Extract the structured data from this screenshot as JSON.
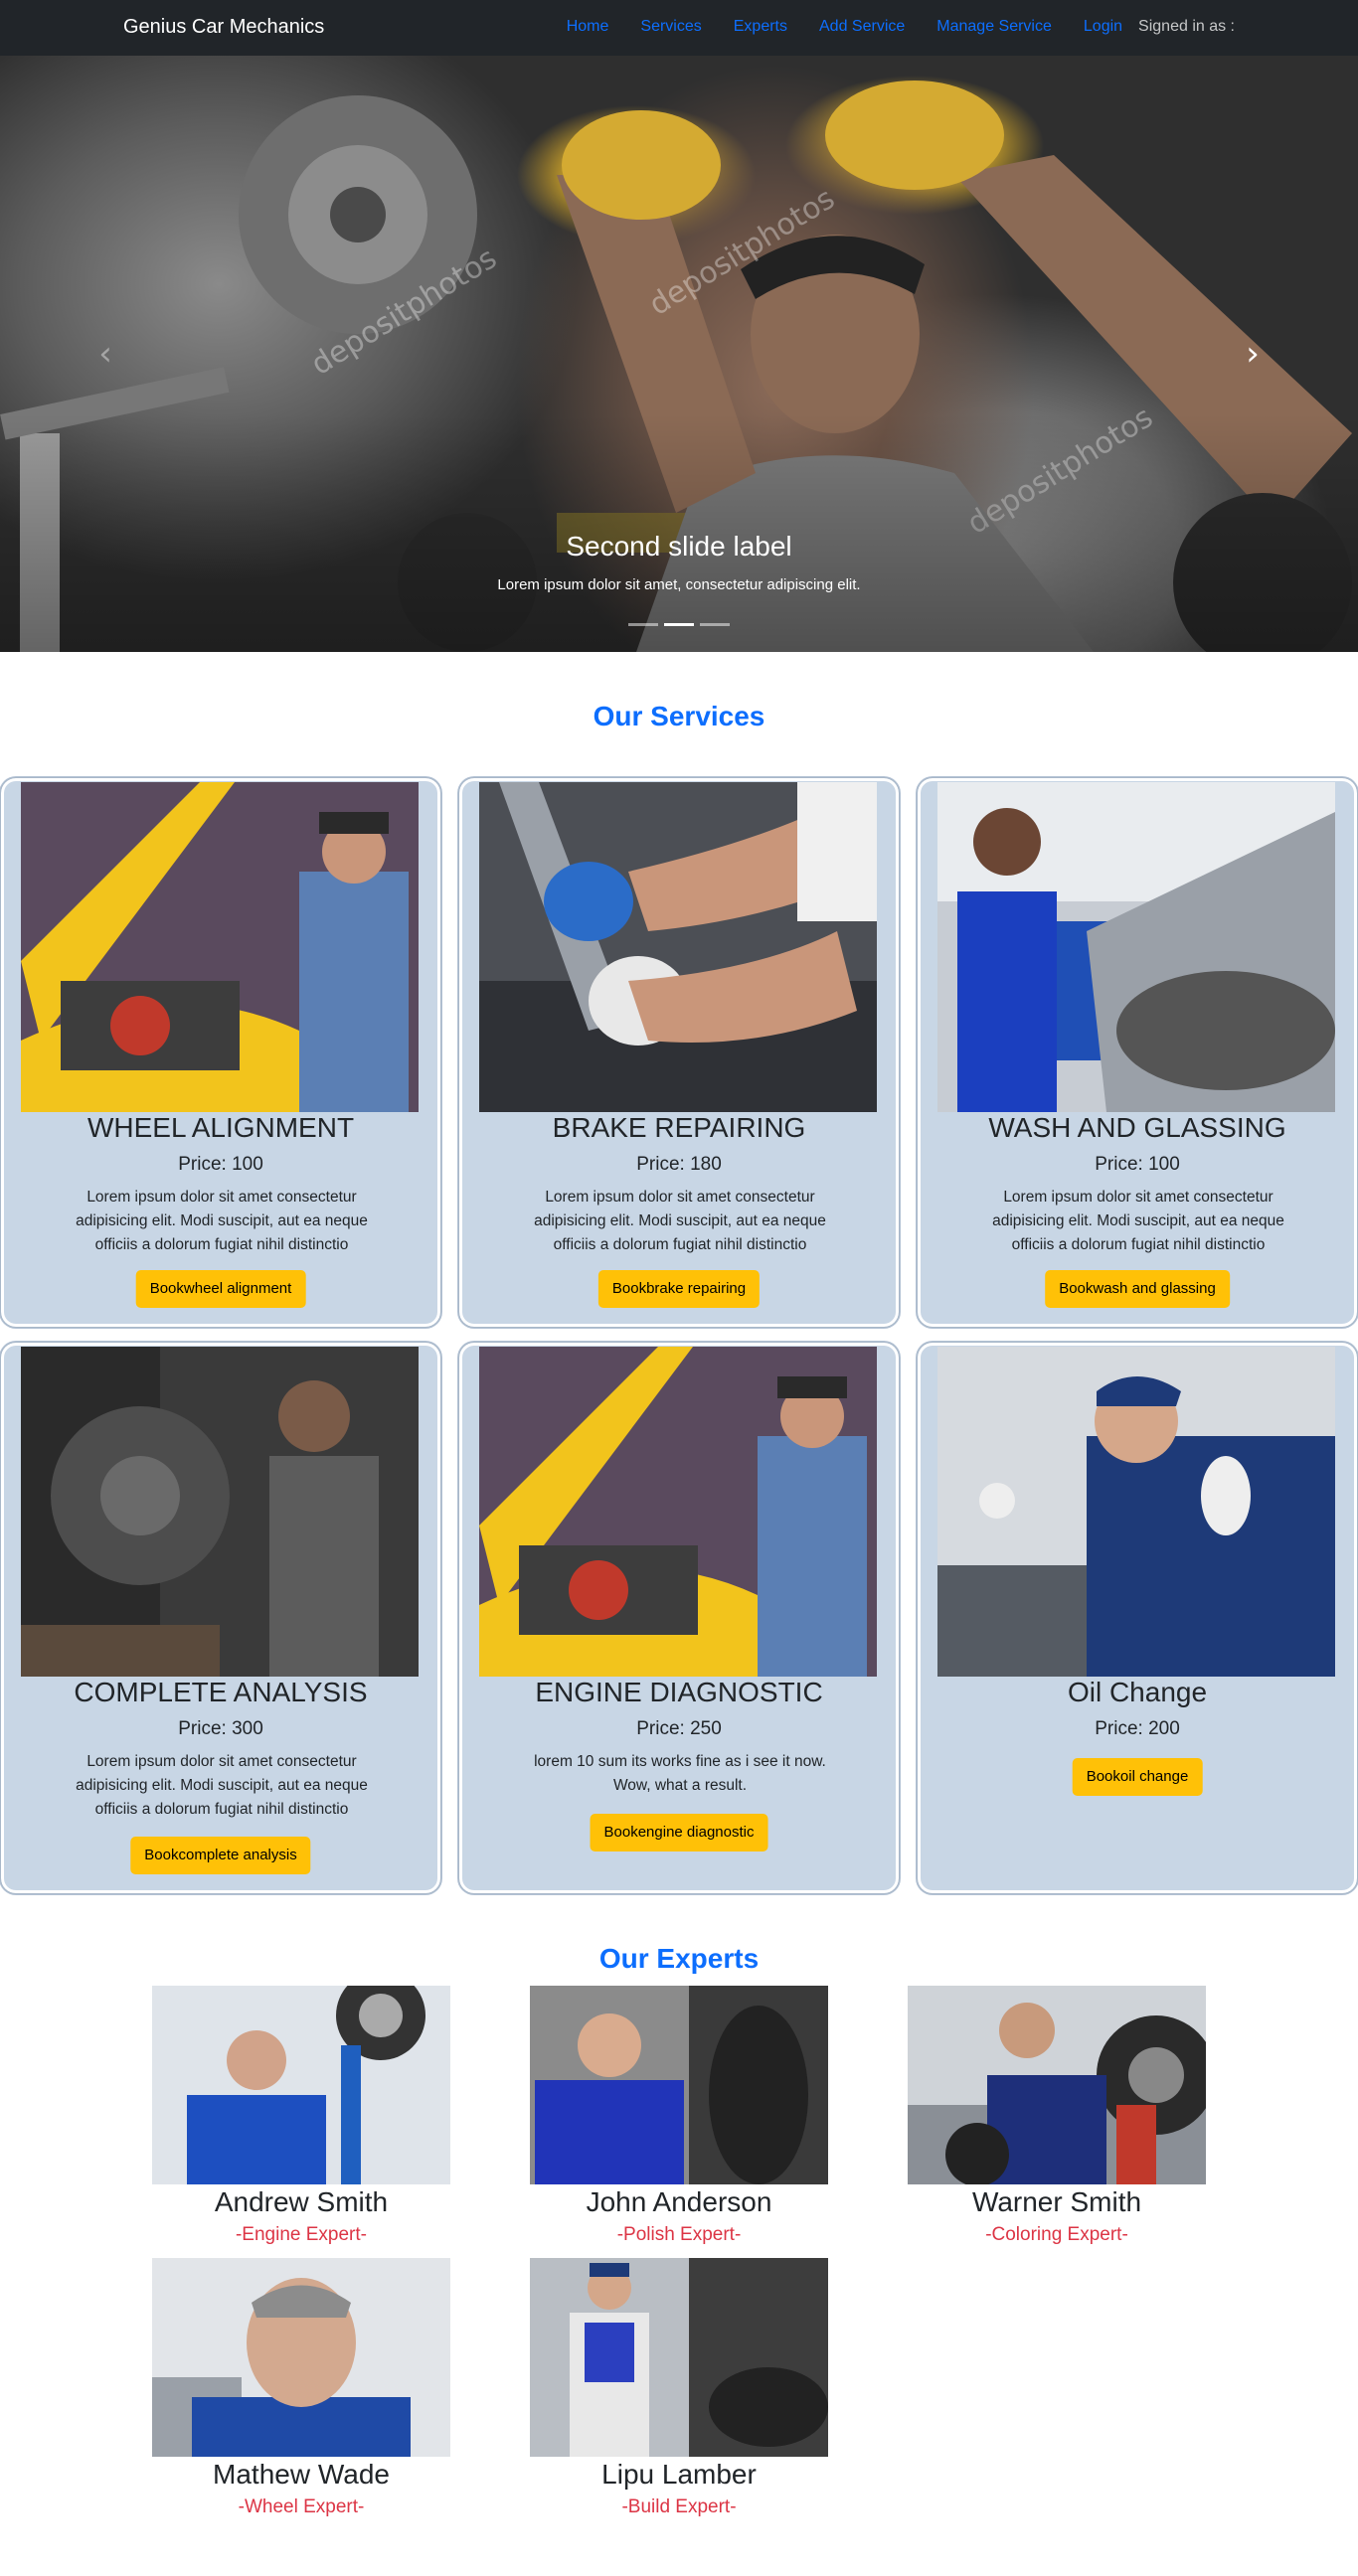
{
  "navbar": {
    "brand": "Genius Car Mechanics",
    "links": [
      "Home",
      "Services",
      "Experts",
      "Add Service",
      "Manage Service",
      "Login"
    ],
    "signed_in": "Signed in as :"
  },
  "carousel": {
    "title": "Second slide label",
    "text": "Lorem ipsum dolor sit amet, consectetur adipiscing elit.",
    "watermark": "depositphotos",
    "prev_glyph": "‹",
    "next_glyph": "›",
    "slide_count": 3,
    "active_slide": 2
  },
  "services": {
    "heading": "Our Services",
    "items": [
      {
        "name": "WHEEL ALIGNMENT",
        "price": "Price: 100",
        "desc": "Lorem ipsum dolor sit amet consectetur adipisicing elit. Modi suscipit, aut ea neque officiis a dolorum fugiat nihil distinctio",
        "button": "Bookwheel alignment"
      },
      {
        "name": "BRAKE REPAIRING",
        "price": "Price: 180",
        "desc": "Lorem ipsum dolor sit amet consectetur adipisicing elit. Modi suscipit, aut ea neque officiis a dolorum fugiat nihil distinctio",
        "button": "Bookbrake repairing"
      },
      {
        "name": "WASH AND GLASSING",
        "price": "Price: 100",
        "desc": "Lorem ipsum dolor sit amet consectetur adipisicing elit. Modi suscipit, aut ea neque officiis a dolorum fugiat nihil distinctio",
        "button": "Bookwash and glassing"
      },
      {
        "name": "COMPLETE ANALYSIS",
        "price": "Price: 300",
        "desc": "Lorem ipsum dolor sit amet consectetur adipisicing elit. Modi suscipit, aut ea neque officiis a dolorum fugiat nihil distinctio",
        "button": "Bookcomplete analysis"
      },
      {
        "name": "ENGINE DIAGNOSTIC",
        "price": "Price: 250",
        "desc": "lorem 10 sum its works fine as i see it now. Wow, what a result.",
        "button": "Bookengine diagnostic"
      },
      {
        "name": "Oil Change",
        "price": "Price: 200",
        "desc": "",
        "button": "Bookoil change"
      }
    ]
  },
  "experts": {
    "heading": "Our Experts",
    "items": [
      {
        "name": "Andrew Smith",
        "role": "-Engine Expert-"
      },
      {
        "name": "John Anderson",
        "role": "-Polish Expert-"
      },
      {
        "name": "Warner Smith",
        "role": "-Coloring Expert-"
      },
      {
        "name": "Mathew Wade",
        "role": "-Wheel Expert-"
      },
      {
        "name": "Lipu Lamber",
        "role": "-Build Expert-"
      }
    ]
  },
  "colors": {
    "navbar_bg": "#212529",
    "link": "#0d6efd",
    "card_bg": "#c8d6e5",
    "button": "#ffc107",
    "expert_role": "#dc3545"
  }
}
